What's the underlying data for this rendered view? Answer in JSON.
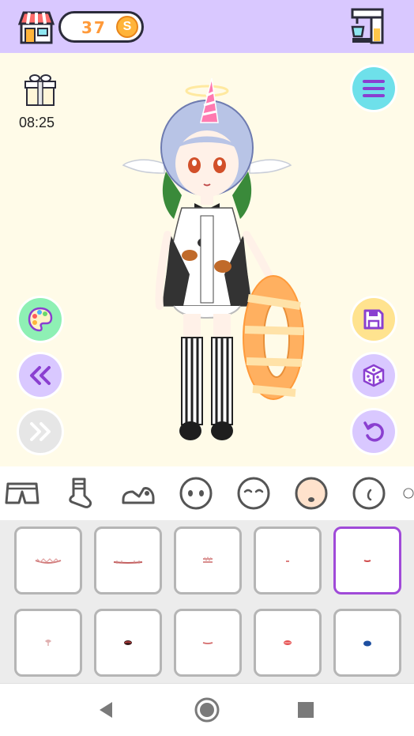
{
  "topbar": {
    "coin_count": "37",
    "coin_symbol": "S"
  },
  "stage": {
    "timer": "08:25"
  },
  "tabs": [
    {
      "name": "shorts",
      "icon": "shorts-icon"
    },
    {
      "name": "socks",
      "icon": "sock-icon"
    },
    {
      "name": "shoes",
      "icon": "shoe-icon"
    },
    {
      "name": "eyes",
      "icon": "face-eyes-icon"
    },
    {
      "name": "eyebrows",
      "icon": "face-closed-eyes-icon"
    },
    {
      "name": "mouth",
      "icon": "face-mouth-icon",
      "selected": true
    },
    {
      "name": "ear",
      "icon": "face-ear-icon"
    }
  ],
  "grid": {
    "selected_index": 4,
    "items": [
      {
        "name": "mouth-1"
      },
      {
        "name": "mouth-2"
      },
      {
        "name": "mouth-3"
      },
      {
        "name": "mouth-4"
      },
      {
        "name": "mouth-5"
      },
      {
        "name": "mouth-6"
      },
      {
        "name": "mouth-7"
      },
      {
        "name": "mouth-8"
      },
      {
        "name": "mouth-9"
      },
      {
        "name": "mouth-10"
      }
    ]
  },
  "colors": {
    "topbar": "#d9c8ff",
    "stage": "#fffbe8",
    "selected_border": "#a04ad8",
    "cell_border": "#b5b5b5"
  }
}
